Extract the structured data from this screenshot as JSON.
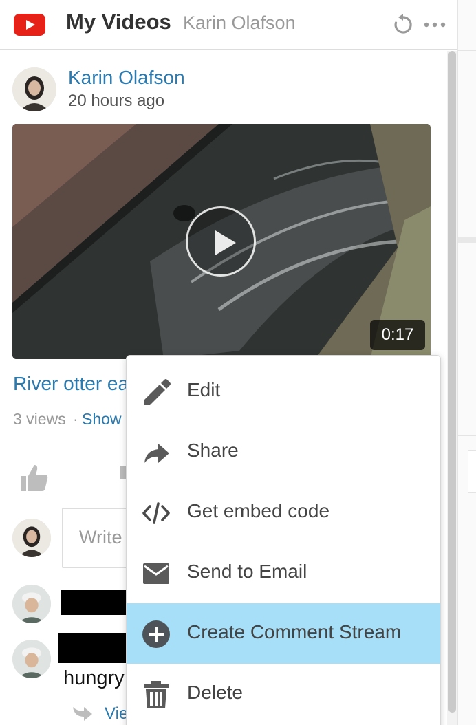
{
  "header": {
    "title": "My Videos",
    "subtitle": "Karin Olafson"
  },
  "post": {
    "author": "Karin Olafson",
    "time": "20 hours ago",
    "video_duration": "0:17",
    "video_title": "River otter ea",
    "views": "3 views",
    "separator": "·",
    "show_link": "Show",
    "comment_placeholder": "Write"
  },
  "comments": {
    "reply_text": "hungry",
    "view_replies": "Vie"
  },
  "menu": {
    "items": [
      {
        "label": "Edit",
        "icon": "pencil-icon"
      },
      {
        "label": "Share",
        "icon": "share-arrow-icon"
      },
      {
        "label": "Get embed code",
        "icon": "code-icon"
      },
      {
        "label": "Send to Email",
        "icon": "envelope-icon"
      },
      {
        "label": "Create Comment Stream",
        "icon": "plus-circle-icon"
      },
      {
        "label": "Delete",
        "icon": "trash-icon"
      }
    ],
    "active_index": 4,
    "highlight_color": "#a6dff7"
  },
  "colors": {
    "link": "#2a7ab0",
    "youtube_red": "#e62117"
  }
}
